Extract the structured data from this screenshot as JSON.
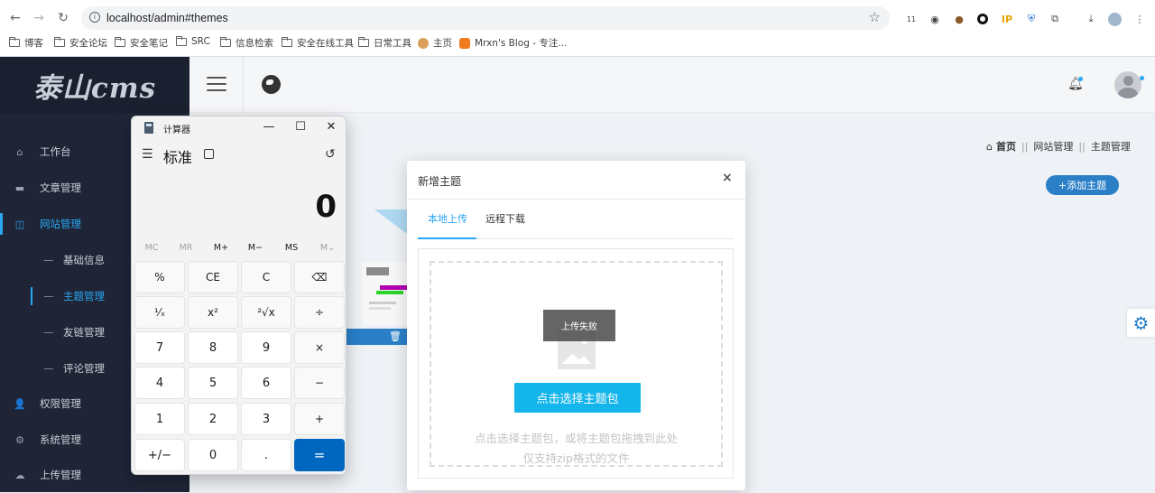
{
  "browser": {
    "url": "localhost/admin#themes",
    "bookmarks": [
      {
        "label": "博客",
        "icon": "folder-icon"
      },
      {
        "label": "安全论坛",
        "icon": "folder-icon"
      },
      {
        "label": "安全笔记",
        "icon": "folder-icon"
      },
      {
        "label": "SRC",
        "icon": "folder-icon"
      },
      {
        "label": "信息检索",
        "icon": "folder-icon"
      },
      {
        "label": "安全在线工具",
        "icon": "folder-icon"
      },
      {
        "label": "日常工具",
        "icon": "folder-icon"
      },
      {
        "label": "主页",
        "icon": "site-favicon-icon"
      },
      {
        "label": "Mrxn's Blog - 专注...",
        "icon": "site-favicon-icon"
      }
    ],
    "extension_ip_label": "IP",
    "extension_badge": "11"
  },
  "cms": {
    "logo": "泰山cms",
    "menu": [
      {
        "label": "工作台",
        "icon": "home-icon"
      },
      {
        "label": "文章管理",
        "icon": "article-icon"
      },
      {
        "label": "网站管理",
        "icon": "website-icon",
        "active": true
      },
      {
        "label": "权限管理",
        "icon": "users-icon"
      },
      {
        "label": "系统管理",
        "icon": "gear-icon"
      },
      {
        "label": "上传管理",
        "icon": "upload-icon"
      }
    ],
    "submenu": [
      {
        "label": "基础信息"
      },
      {
        "label": "主题管理",
        "active": true
      },
      {
        "label": "友链管理"
      },
      {
        "label": "评论管理"
      }
    ],
    "breadcrumb": {
      "home": "首页",
      "sep": "||",
      "level1": "网站管理",
      "level2": "主题管理"
    },
    "add_theme_button": "+添加主题",
    "accent_color": "#2aa6f2"
  },
  "calculator": {
    "title": "计算器",
    "mode": "标准",
    "display": "0",
    "memory": [
      "MC",
      "MR",
      "M+",
      "M−",
      "MS",
      "M⌄"
    ],
    "keys": [
      [
        "%",
        "CE",
        "C",
        "⌫"
      ],
      [
        "¹⁄ₓ",
        "x²",
        "²√x",
        "÷"
      ],
      [
        "7",
        "8",
        "9",
        "×"
      ],
      [
        "4",
        "5",
        "6",
        "−"
      ],
      [
        "1",
        "2",
        "3",
        "+"
      ],
      [
        "+/−",
        "0",
        ".",
        "="
      ]
    ]
  },
  "dialog": {
    "title": "新增主题",
    "close": "×",
    "tabs": [
      "本地上传",
      "远程下载"
    ],
    "toast": "上传失败",
    "choose_button": "点击选择主题包",
    "hint_line1": "点击选择主题包，或将主题包拖拽到此处",
    "hint_line2": "仅支持zip格式的文件"
  }
}
